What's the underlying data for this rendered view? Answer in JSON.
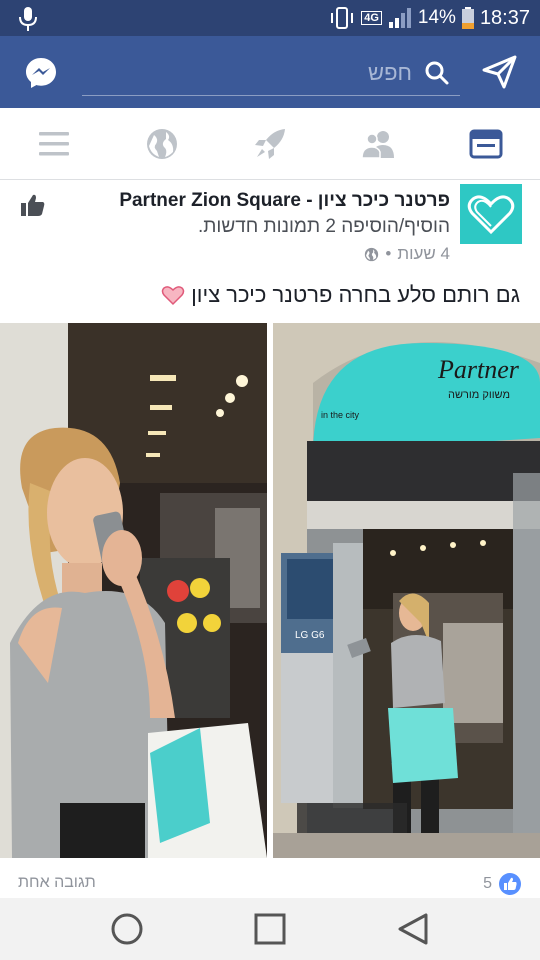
{
  "status_bar": {
    "network": "4G",
    "battery": "14%",
    "time": "18:37"
  },
  "header": {
    "search_placeholder": "חפש",
    "icons": [
      "messenger-icon",
      "search-icon",
      "send-icon"
    ]
  },
  "tabs": [
    {
      "name": "feed",
      "icon": "news-feed-icon",
      "active": true
    },
    {
      "name": "friends",
      "icon": "friends-icon",
      "active": false
    },
    {
      "name": "discover",
      "icon": "rocket-icon",
      "active": false
    },
    {
      "name": "notifications",
      "icon": "globe-icon",
      "active": false
    },
    {
      "name": "menu",
      "icon": "menu-icon",
      "active": false
    }
  ],
  "post": {
    "page_name": "פרטנר כיכר ציון - Partner Zion Square",
    "action": "הוסיף/הוסיפה 2 תמונות חדשות.",
    "time": "4 שעות",
    "privacy_icon": "globe-icon",
    "text": "גם רותם סלע בחרה פרטנר כיכר  ציון",
    "photos": {
      "store_sign_brand": "Partner",
      "store_sign_sub": "משווק מורשה",
      "store_sign_city": "in the city",
      "poster_text": "LG G6"
    },
    "comments": "תגובה אחת",
    "likes": "5"
  },
  "colors": {
    "fb_blue": "#3b5998",
    "status_blue": "#2d4373",
    "partner_teal": "#2ec8c4"
  }
}
